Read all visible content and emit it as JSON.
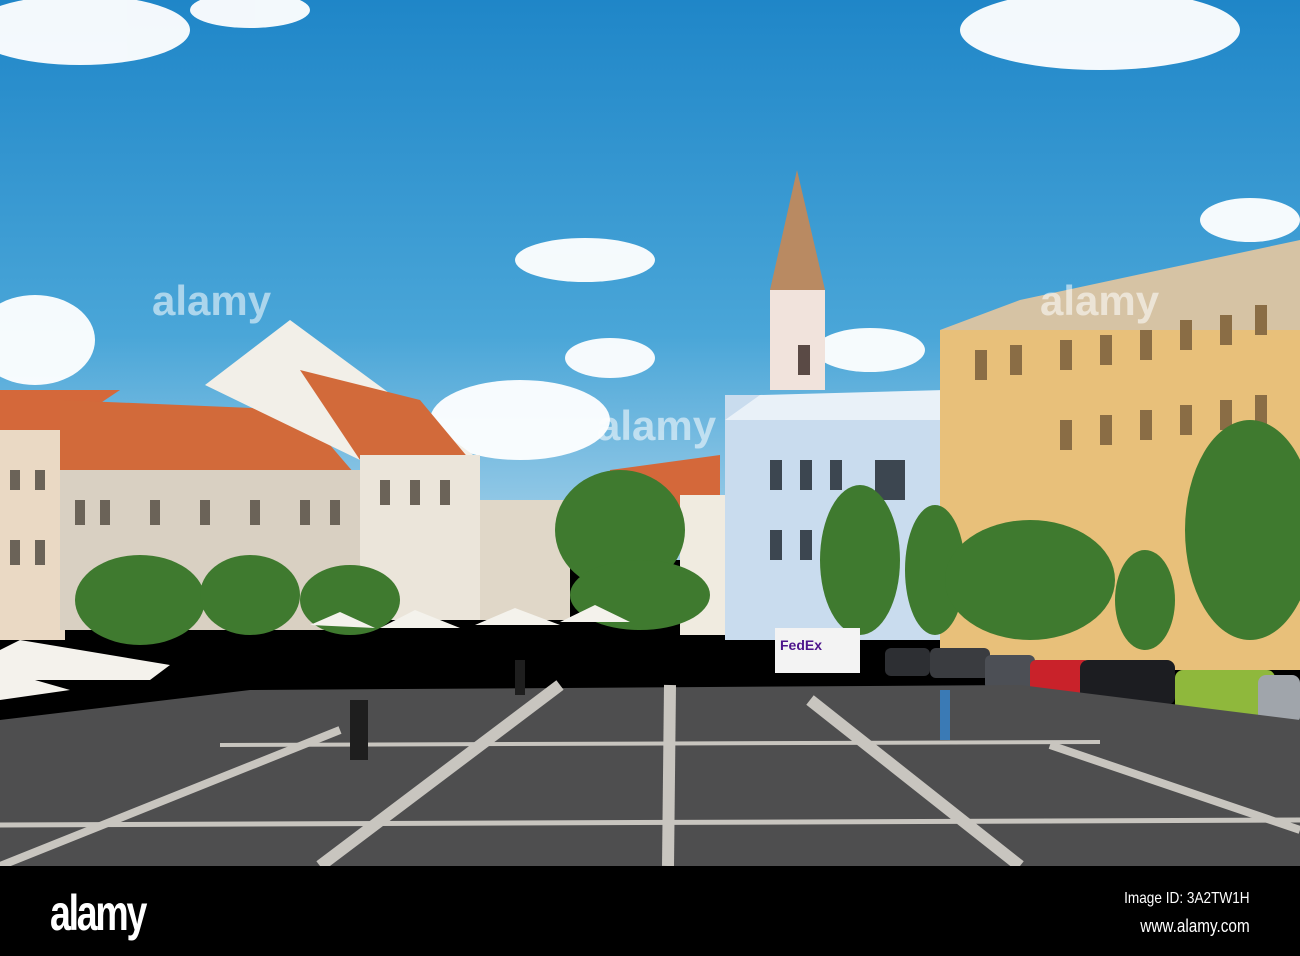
{
  "photo": {
    "subject": "Town hall square street view",
    "watermark_text": "alamy",
    "truck_text": "FedEx"
  },
  "footer": {
    "logo": "alamy",
    "image_id": "Image ID: 3A2TW1H",
    "website": "www.alamy.com"
  }
}
